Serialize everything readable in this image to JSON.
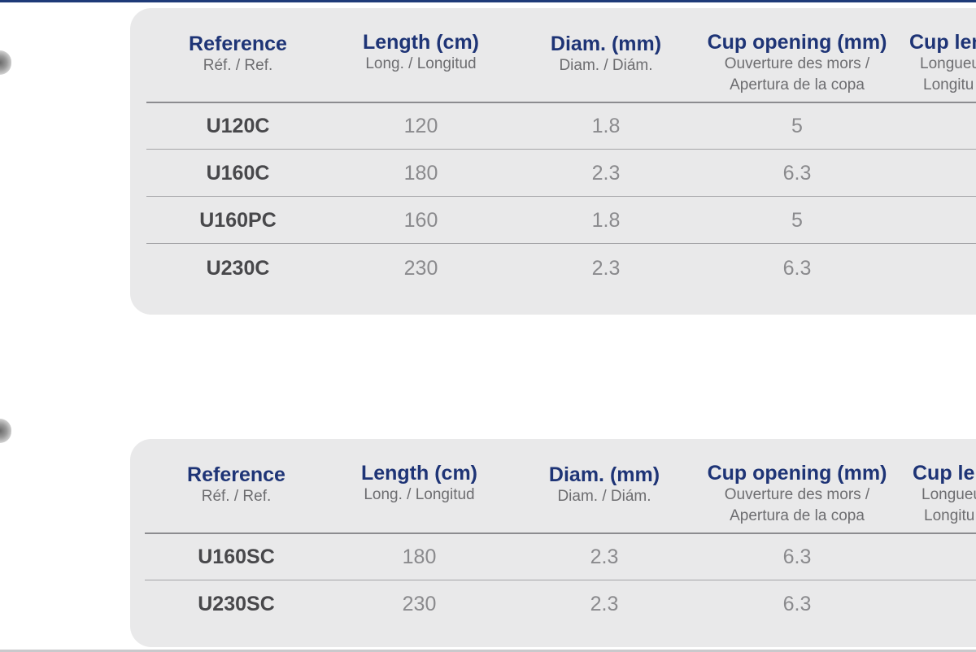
{
  "tables": [
    {
      "headers": [
        {
          "main": "Reference",
          "sub1": "Réf. / Ref.",
          "sub2": ""
        },
        {
          "main": "Length (cm)",
          "sub1": "Long. / Longitud",
          "sub2": ""
        },
        {
          "main": "Diam. (mm)",
          "sub1": "Diam. / Diám.",
          "sub2": ""
        },
        {
          "main": "Cup opening (mm)",
          "sub1": "Ouverture des mors /",
          "sub2": "Apertura de la copa"
        },
        {
          "main": "Cup len",
          "sub1": "Longueu",
          "sub2": "Longitu"
        }
      ],
      "rows": [
        [
          "U120C",
          "120",
          "1.8",
          "5"
        ],
        [
          "U160C",
          "180",
          "2.3",
          "6.3"
        ],
        [
          "U160PC",
          "160",
          "1.8",
          "5"
        ],
        [
          "U230C",
          "230",
          "2.3",
          "6.3"
        ]
      ]
    },
    {
      "headers": [
        {
          "main": "Reference",
          "sub1": "Réf. / Ref.",
          "sub2": ""
        },
        {
          "main": "Length (cm)",
          "sub1": "Long. / Longitud",
          "sub2": ""
        },
        {
          "main": "Diam. (mm)",
          "sub1": "Diam. / Diám.",
          "sub2": ""
        },
        {
          "main": "Cup opening (mm)",
          "sub1": "Ouverture des mors /",
          "sub2": "Apertura de la copa"
        },
        {
          "main": "Cup len",
          "sub1": "Longueu",
          "sub2": "Longitu"
        }
      ],
      "rows": [
        [
          "U160SC",
          "180",
          "2.3",
          "6.3"
        ],
        [
          "U230SC",
          "230",
          "2.3",
          "6.3"
        ]
      ]
    }
  ],
  "colors": {
    "header": "#1e3476",
    "subheader": "#6d6d70",
    "reference": "#48484b",
    "value": "#8a8a8d",
    "panel": "#e9e9ea",
    "top_rule": "#1e3a78"
  }
}
